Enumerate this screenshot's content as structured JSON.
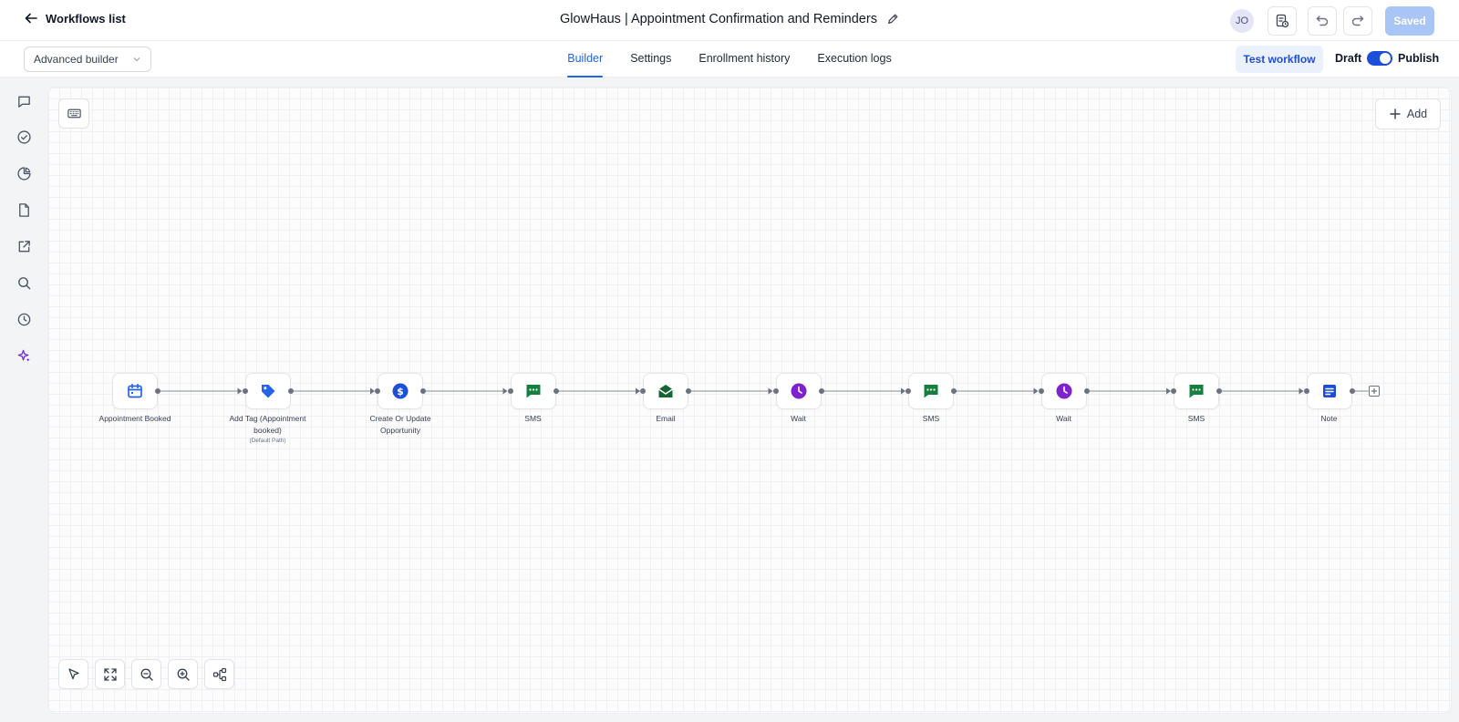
{
  "header": {
    "back_label": "Workflows list",
    "workflow_title": "GlowHaus | Appointment Confirmation and Reminders",
    "avatar_initials": "JO",
    "saved_label": "Saved"
  },
  "subbar": {
    "builder_mode": "Advanced builder",
    "tabs": [
      {
        "label": "Builder",
        "active": true
      },
      {
        "label": "Settings",
        "active": false
      },
      {
        "label": "Enrollment history",
        "active": false
      },
      {
        "label": "Execution logs",
        "active": false
      }
    ],
    "test_label": "Test workflow",
    "draft_label": "Draft",
    "publish_label": "Publish",
    "published": true
  },
  "sidebar": {
    "icons": [
      "chat-icon",
      "check-circle-icon",
      "pie-chart-icon",
      "document-icon",
      "external-link-icon",
      "search-icon",
      "history-icon",
      "ai-sparkle-icon"
    ]
  },
  "canvas": {
    "add_label": "Add",
    "nodes": [
      {
        "label": "Appointment Booked",
        "sub": "",
        "icon": "calendar-icon",
        "color": "#2563eb"
      },
      {
        "label": "Add Tag (Appointment booked)",
        "sub": "(Default Path)",
        "icon": "tag-icon",
        "color": "#2563eb"
      },
      {
        "label": "Create Or Update Opportunity",
        "sub": "",
        "icon": "dollar-icon",
        "color": "#1d4ed8"
      },
      {
        "label": "SMS",
        "sub": "",
        "icon": "sms-icon",
        "color": "#15803d"
      },
      {
        "label": "Email",
        "sub": "",
        "icon": "email-icon",
        "color": "#166534"
      },
      {
        "label": "Wait",
        "sub": "",
        "icon": "clock-icon",
        "color": "#7e22ce"
      },
      {
        "label": "SMS",
        "sub": "",
        "icon": "sms-icon",
        "color": "#15803d"
      },
      {
        "label": "Wait",
        "sub": "",
        "icon": "clock-icon",
        "color": "#7e22ce"
      },
      {
        "label": "SMS",
        "sub": "",
        "icon": "sms-icon",
        "color": "#15803d"
      },
      {
        "label": "Note",
        "sub": "",
        "icon": "note-icon",
        "color": "#1d4ed8"
      }
    ],
    "tools": [
      "select-pointer-icon",
      "fit-view-icon",
      "zoom-out-icon",
      "zoom-in-icon",
      "auto-layout-icon"
    ]
  },
  "colors": {
    "accent": "#2563eb",
    "saved_button": "#a9c5f5"
  }
}
